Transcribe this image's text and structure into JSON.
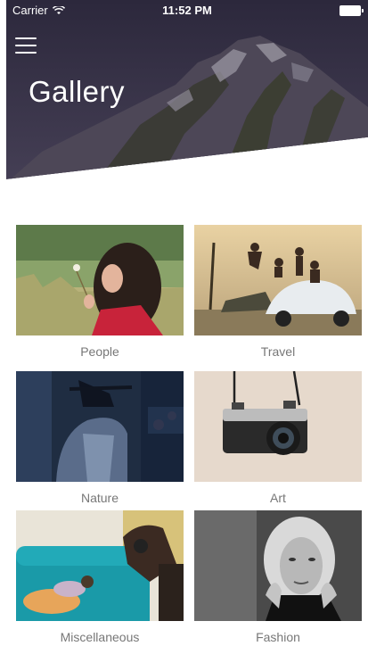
{
  "status_bar": {
    "carrier": "Carrier",
    "time": "11:52 PM"
  },
  "header": {
    "title": "Gallery",
    "menu_icon": "hamburger-menu-icon"
  },
  "gallery": {
    "items": [
      {
        "label": "People"
      },
      {
        "label": "Travel"
      },
      {
        "label": "Nature"
      },
      {
        "label": "Art"
      },
      {
        "label": "Miscellaneous"
      },
      {
        "label": "Fashion"
      }
    ]
  },
  "colors": {
    "header_bg": "#3b3550",
    "label_text": "#777777"
  }
}
